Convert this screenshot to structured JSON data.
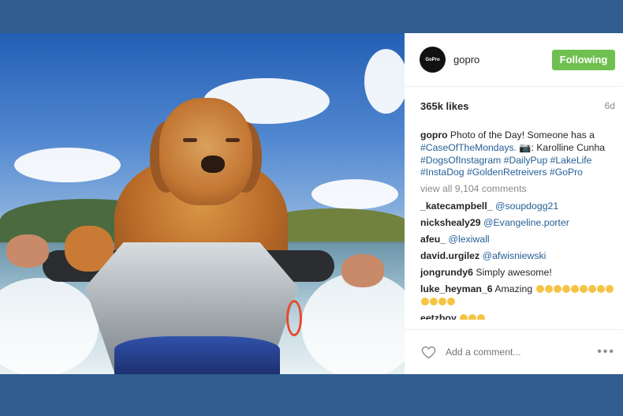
{
  "account": {
    "username": "gopro",
    "avatar_label": "GoPro",
    "follow_button_label": "Following"
  },
  "post": {
    "likes": "365k likes",
    "time": "6d",
    "caption_prefix": "gopro",
    "caption_text_1": "Photo of the Day! Someone has a",
    "caption_tag_1": "#CaseOfTheMondays.",
    "caption_text_2": ": Karolline Cunha",
    "caption_tags_line": "#DogsOfInstagram #DailyPup #LakeLife",
    "caption_tags_line_2": "#InstaDog #GoldenRetreivers #GoPro",
    "view_all_comments": "view all 9,104 comments"
  },
  "comments": [
    {
      "user": "_katecampbell_",
      "text": "@soupdogg21"
    },
    {
      "user": "nickshealy29",
      "text": "@Evangeline.porter"
    },
    {
      "user": "afeu_",
      "text": "@lexiwall"
    },
    {
      "user": "david.urgilez",
      "text": "@afwisniewski"
    },
    {
      "user": "jongrundy6",
      "text": "Simply awesome!"
    },
    {
      "user": "luke_heyman_6",
      "text": "Amazing"
    },
    {
      "user": "eetzboy",
      "text": ""
    }
  ],
  "add_comment": {
    "placeholder": "Add a comment...",
    "more_icon": "•••"
  },
  "icons": {
    "heart": "heart-icon",
    "camera": "camera-icon",
    "more": "more-icon",
    "emoji": "emoji-icon"
  },
  "colors": {
    "background": "#2f5d8f",
    "following_button": "#70c050",
    "hashtag": "#245f96"
  }
}
